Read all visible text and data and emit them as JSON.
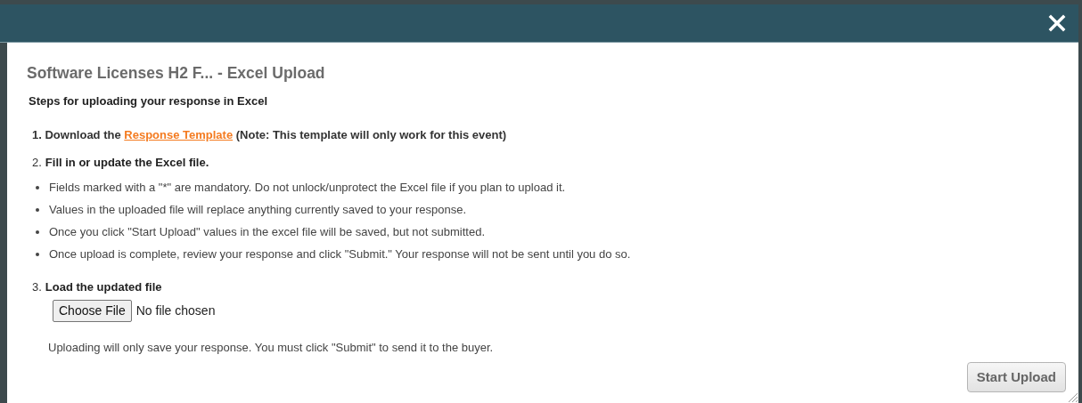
{
  "dialog": {
    "title": "Software Licenses H2 F... - Excel Upload",
    "subtitle": "Steps for uploading your response in Excel"
  },
  "step_1": {
    "text_before": "1. Download the ",
    "link": "Response Template",
    "text_after": " (Note: This template will only work for this event)"
  },
  "step_2": {
    "number": "2.",
    "title": "Fill in or update the Excel file.",
    "bullets": [
      "Fields marked with a \"*\" are mandatory. Do not unlock/unprotect the Excel file if you plan to upload it.",
      "Values in the uploaded file will replace anything currently saved to your response.",
      "Once you click \"Start Upload\" values in the excel file will be saved, but not submitted.",
      "Once upload is complete, review your response and click \"Submit.\" Your response will not be sent until you do so."
    ]
  },
  "step_3": {
    "number": "3.",
    "title": "Load the updated file",
    "file_button": "Choose File",
    "file_status": "No file chosen",
    "note": "Uploading will only save your response. You must click \"Submit\" to send it to the buyer."
  },
  "buttons": [
    "Start Upload"
  ]
}
